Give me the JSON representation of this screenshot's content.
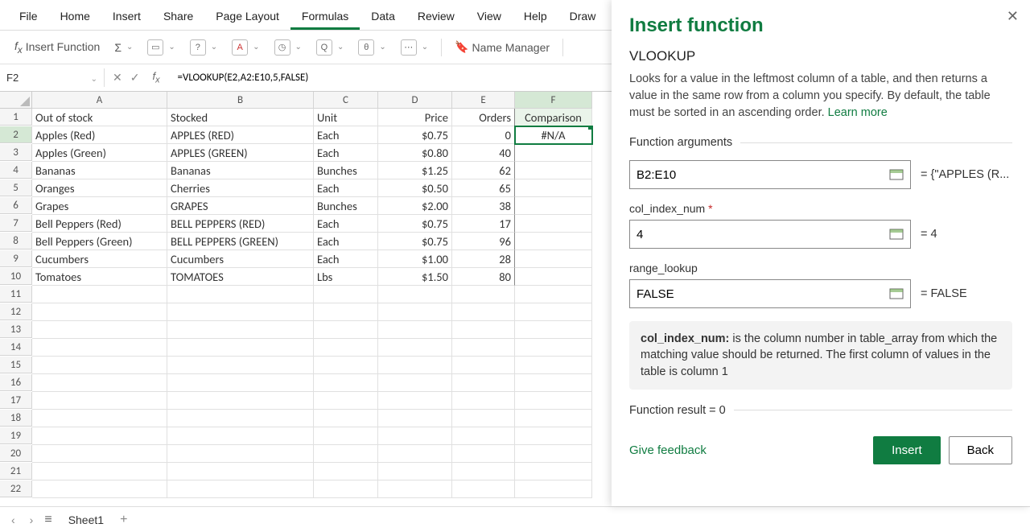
{
  "ribbon": {
    "tabs": [
      "File",
      "Home",
      "Insert",
      "Share",
      "Page Layout",
      "Formulas",
      "Data",
      "Review",
      "View",
      "Help",
      "Draw"
    ],
    "active": "Formulas"
  },
  "toolbar": {
    "insert_fn": "Insert Function",
    "sum_icon": "Σ",
    "name_manager": "Name Manager"
  },
  "formula_bar": {
    "cell_ref": "F2",
    "formula": "=VLOOKUP(E2,A2:E10,5,FALSE)"
  },
  "columns": [
    "A",
    "B",
    "C",
    "D",
    "E",
    "F"
  ],
  "table": {
    "headers": [
      "Out of stock",
      "Stocked",
      "Unit",
      "Price",
      "Orders",
      "Comparison"
    ],
    "rows": [
      [
        "Apples (Red)",
        "APPLES (RED)",
        "Each",
        "$0.75",
        "0",
        "#N/A"
      ],
      [
        "Apples (Green)",
        "APPLES (GREEN)",
        "Each",
        "$0.80",
        "40",
        ""
      ],
      [
        "Bananas",
        "Bananas",
        "Bunches",
        "$1.25",
        "62",
        ""
      ],
      [
        "Oranges",
        "Cherries",
        "Each",
        "$0.50",
        "65",
        ""
      ],
      [
        "Grapes",
        "GRAPES",
        "Bunches",
        "$2.00",
        "38",
        ""
      ],
      [
        "Bell Peppers (Red)",
        "BELL PEPPERS (RED)",
        "Each",
        "$0.75",
        "17",
        ""
      ],
      [
        "Bell Peppers (Green)",
        "BELL PEPPERS (GREEN)",
        "Each",
        "$0.75",
        "96",
        ""
      ],
      [
        "Cucumbers",
        "Cucumbers",
        "Each",
        "$1.00",
        "28",
        ""
      ],
      [
        "Tomatoes",
        "TOMATOES",
        "Lbs",
        "$1.50",
        "80",
        ""
      ]
    ],
    "last_row_shown": 22
  },
  "panel": {
    "title": "Insert function",
    "fn": "VLOOKUP",
    "desc": "Looks for a value in the leftmost column of a table, and then returns a value in the same row from a column you specify. By default, the table must be sorted in an ascending order. ",
    "learn_more": "Learn more",
    "section_args": "Function arguments",
    "arg1": {
      "value": "B2:E10",
      "result": "= {\"APPLES (R..."
    },
    "arg2": {
      "label": "col_index_num",
      "required": "*",
      "value": "4",
      "result": "= 4"
    },
    "arg3": {
      "label": "range_lookup",
      "value": "FALSE",
      "result": "= FALSE"
    },
    "note_lead": "col_index_num:",
    "note_body": " is the column number in table_array from which the matching value should be returned. The first column of values in the table is column 1",
    "result_label": "Function result = ",
    "result_value": "0",
    "feedback": "Give feedback",
    "insert": "Insert",
    "back": "Back"
  },
  "sheet_bar": {
    "sheet": "Sheet1"
  }
}
